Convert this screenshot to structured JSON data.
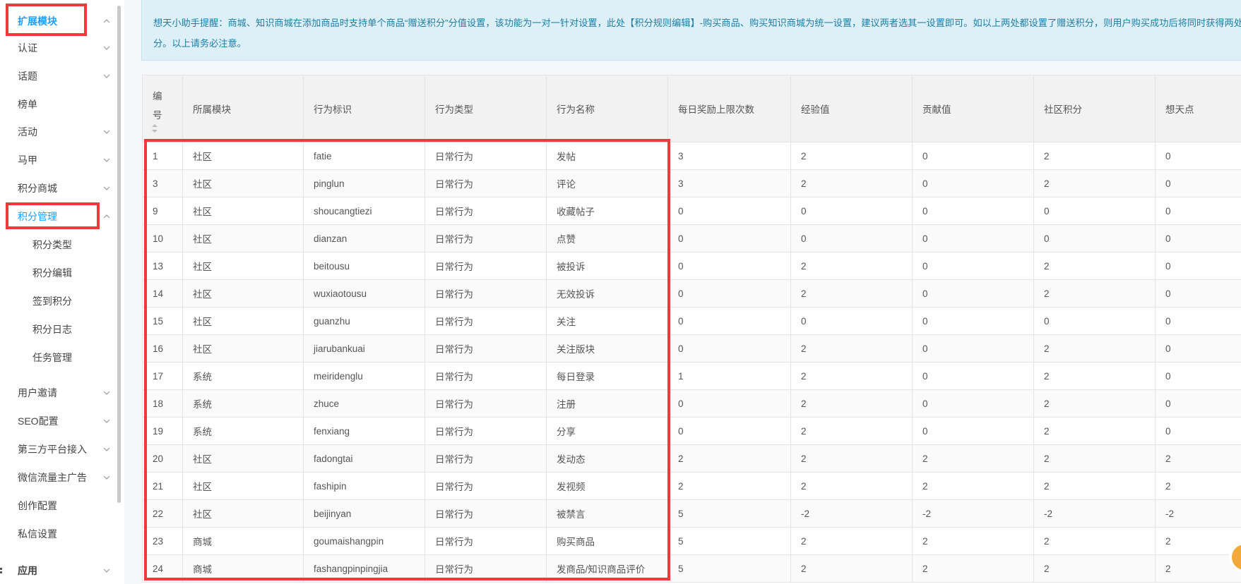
{
  "sidebar": {
    "items": [
      {
        "label": "扩展模块",
        "state": "expanded"
      },
      {
        "label": "认证",
        "state": "collapsed"
      },
      {
        "label": "话题",
        "state": "collapsed"
      },
      {
        "label": "榜单",
        "state": "leaf"
      },
      {
        "label": "活动",
        "state": "collapsed"
      },
      {
        "label": "马甲",
        "state": "collapsed"
      },
      {
        "label": "积分商城",
        "state": "collapsed"
      },
      {
        "label": "积分管理",
        "state": "expanded"
      },
      {
        "label": "用户邀请",
        "state": "collapsed"
      },
      {
        "label": "SEO配置",
        "state": "collapsed"
      },
      {
        "label": "第三方平台接入",
        "state": "collapsed"
      },
      {
        "label": "微信流量主广告",
        "state": "collapsed"
      },
      {
        "label": "创作配置",
        "state": "leaf"
      },
      {
        "label": "私信设置",
        "state": "leaf"
      },
      {
        "label": "应用",
        "state": "collapsed"
      }
    ],
    "sub_items": [
      "积分类型",
      "积分编辑",
      "签到积分",
      "积分日志",
      "任务管理"
    ]
  },
  "notice": {
    "line1": "想天小助手提醒：商城、知识商城在添加商品时支持单个商品“赠送积分”分值设置，该功能为一对一针对设置，此处【积分规则编辑】-购买商品、购买知识商城为统一设置，建议两者选其一设置即可。如以上两处都设置了赠送积分，则用户购买成功后将同时获得两处",
    "line2": "分。以上请务必注意。"
  },
  "table": {
    "headers": [
      "编号",
      "所属模块",
      "行为标识",
      "行为类型",
      "行为名称",
      "每日奖励上限次数",
      "经验值",
      "贡献值",
      "社区积分",
      "想天点"
    ],
    "id_header_lines": [
      "编",
      "号"
    ],
    "rows": [
      [
        "1",
        "社区",
        "fatie",
        "日常行为",
        "发帖",
        "3",
        "2",
        "0",
        "2",
        "0"
      ],
      [
        "3",
        "社区",
        "pinglun",
        "日常行为",
        "评论",
        "3",
        "2",
        "0",
        "2",
        "0"
      ],
      [
        "9",
        "社区",
        "shoucangtiezi",
        "日常行为",
        "收藏帖子",
        "0",
        "0",
        "0",
        "0",
        "0"
      ],
      [
        "10",
        "社区",
        "dianzan",
        "日常行为",
        "点赞",
        "0",
        "0",
        "0",
        "0",
        "0"
      ],
      [
        "13",
        "社区",
        "beitousu",
        "日常行为",
        "被投诉",
        "0",
        "2",
        "0",
        "2",
        "0"
      ],
      [
        "14",
        "社区",
        "wuxiaotousu",
        "日常行为",
        "无效投诉",
        "0",
        "2",
        "0",
        "2",
        "0"
      ],
      [
        "15",
        "社区",
        "guanzhu",
        "日常行为",
        "关注",
        "0",
        "0",
        "0",
        "0",
        "0"
      ],
      [
        "16",
        "社区",
        "jiarubankuai",
        "日常行为",
        "关注版块",
        "0",
        "2",
        "0",
        "2",
        "0"
      ],
      [
        "17",
        "系统",
        "meiridenglu",
        "日常行为",
        "每日登录",
        "1",
        "2",
        "0",
        "2",
        "0"
      ],
      [
        "18",
        "系统",
        "zhuce",
        "日常行为",
        "注册",
        "0",
        "2",
        "0",
        "2",
        "0"
      ],
      [
        "19",
        "系统",
        "fenxiang",
        "日常行为",
        "分享",
        "0",
        "2",
        "0",
        "2",
        "0"
      ],
      [
        "20",
        "社区",
        "fadongtai",
        "日常行为",
        "发动态",
        "2",
        "2",
        "2",
        "2",
        "2"
      ],
      [
        "21",
        "社区",
        "fashipin",
        "日常行为",
        "发视频",
        "2",
        "2",
        "2",
        "2",
        "2"
      ],
      [
        "22",
        "社区",
        "beijinyan",
        "日常行为",
        "被禁言",
        "5",
        "-2",
        "-2",
        "-2",
        "-2"
      ],
      [
        "23",
        "商城",
        "goumaishangpin",
        "日常行为",
        "购买商品",
        "5",
        "2",
        "2",
        "2",
        "2"
      ],
      [
        "24",
        "商城",
        "fashangpinpingjia",
        "日常行为",
        "发商品/知识商品评价",
        "5",
        "2",
        "2",
        "2",
        "2"
      ]
    ]
  },
  "colors": {
    "accent": "#1e9fff",
    "highlight": "#ee3a3a",
    "notice_bg": "#ddf0f7",
    "notice_text": "#1d7ea7"
  },
  "icons": {
    "collapsed": "chevron-down-icon",
    "expanded": "chevron-up-icon",
    "sort": "sort-icon",
    "app": "app-icon"
  }
}
